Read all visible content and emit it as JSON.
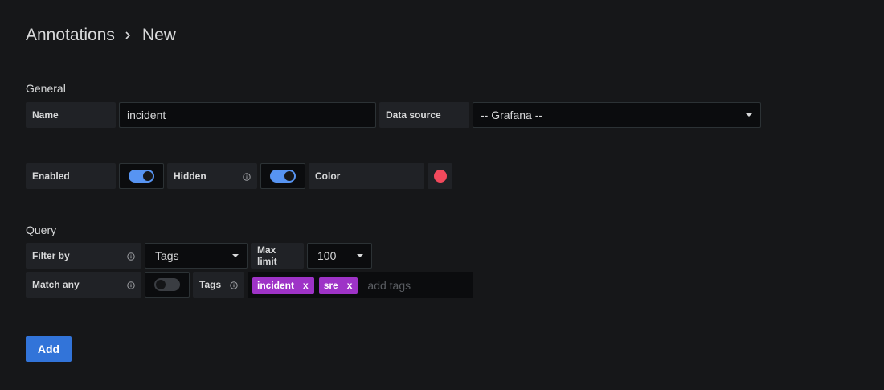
{
  "breadcrumb": {
    "parent": "Annotations",
    "current": "New"
  },
  "general": {
    "title": "General",
    "name_label": "Name",
    "name_value": "incident",
    "datasource_label": "Data source",
    "datasource_value": "-- Grafana --",
    "enabled_label": "Enabled",
    "enabled": true,
    "hidden_label": "Hidden",
    "hidden": true,
    "color_label": "Color",
    "color_value": "#f2495c"
  },
  "query": {
    "title": "Query",
    "filter_by_label": "Filter by",
    "filter_by_value": "Tags",
    "max_limit_label": "Max limit",
    "max_limit_value": "100",
    "match_any_label": "Match any",
    "match_any": false,
    "tags_label": "Tags",
    "tags": [
      "incident",
      "sre"
    ],
    "tags_placeholder": "add tags",
    "tag_remove": "x"
  },
  "actions": {
    "add_label": "Add"
  },
  "colors": {
    "accent": "#5794f2",
    "tag": "#9e33c7",
    "primary_button": "#3274d9"
  },
  "icons": {
    "breadcrumb_sep": "chevron-right-icon",
    "info": "info-circle-icon",
    "caret": "caret-down-icon"
  }
}
